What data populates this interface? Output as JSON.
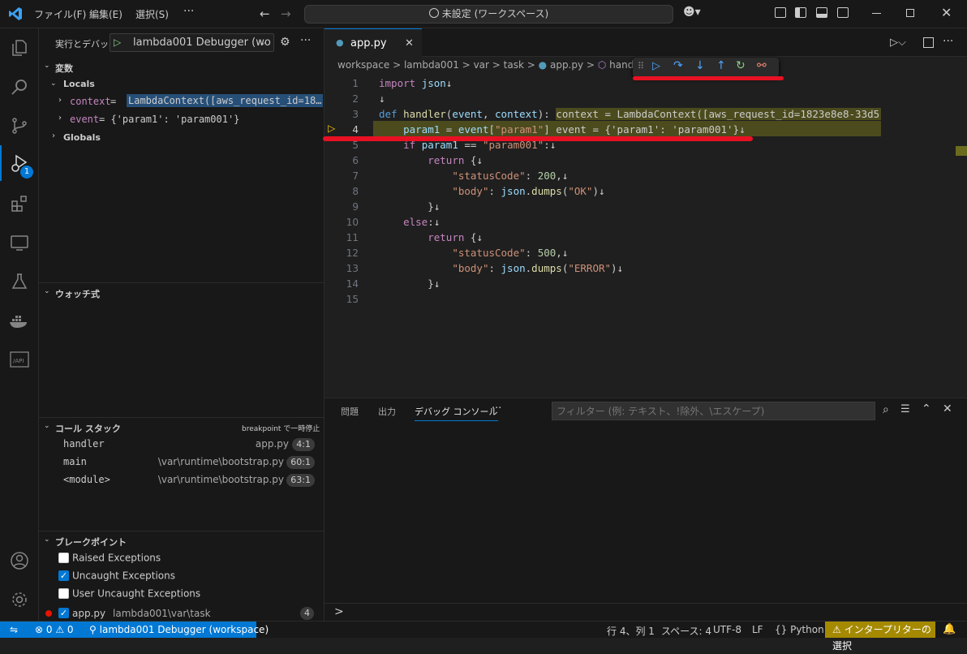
{
  "titlebar": {
    "menu_file": "ファイル(F)",
    "menu_edit": "編集(E)",
    "menu_select": "選択(S)",
    "menu_more": "···",
    "search": "未設定 (ワークスペース)"
  },
  "sidebar": {
    "run_label": "実行とデバッグ",
    "config": "lambda001 Debugger (wo",
    "variables": "変数",
    "locals": "Locals",
    "var_context_name": "context",
    "var_context_eq": " = ",
    "var_context_val": "LambdaContext([aws_request_id=18…",
    "var_event_name": "event",
    "var_event_val": " = {'param1': 'param001'}",
    "globals": "Globals",
    "watch": "ウォッチ式",
    "callstack": "コール スタック",
    "callstack_status": "breakpoint で一時停止",
    "frames": [
      {
        "name": "handler",
        "file": "app.py",
        "pos": "4:1"
      },
      {
        "name": "main",
        "file": "\\var\\runtime\\bootstrap.py",
        "pos": "60:1"
      },
      {
        "name": "<module>",
        "file": "\\var\\runtime\\bootstrap.py",
        "pos": "63:1"
      }
    ],
    "breakpoints": "ブレークポイント",
    "bp_raised": "Raised Exceptions",
    "bp_uncaught": "Uncaught Exceptions",
    "bp_user": "User Uncaught Exceptions",
    "bp_file": "app.py",
    "bp_path": "lambda001\\var\\task",
    "bp_line": "4"
  },
  "activity": {
    "debug_badge": "1"
  },
  "editor": {
    "tab": "app.py",
    "breadcrumb": [
      "workspace",
      ">",
      "lambda001",
      ">",
      "var",
      ">",
      "task",
      ">",
      "app.py",
      ">",
      "handle"
    ],
    "lines": [
      "1",
      "2",
      "3",
      "4",
      "5",
      "6",
      "7",
      "8",
      "9",
      "10",
      "11",
      "12",
      "13",
      "14",
      "15"
    ]
  },
  "panel": {
    "tab_problems": "問題",
    "tab_output": "出力",
    "tab_debug": "デバッグ コンソール",
    "tab_more": "···",
    "filter_placeholder": "フィルター (例: テキスト、!除外、\\エスケープ)",
    "prompt": ">"
  },
  "status": {
    "errors": "0",
    "warnings": "0",
    "debug": "lambda001 Debugger (workspace)",
    "pos": "行 4、列 1",
    "spaces": "スペース: 4",
    "encoding": "UTF-8",
    "eol": "LF",
    "lang": "Python",
    "interpreter": "インタープリターの選択"
  },
  "colors": {
    "accent": "#0078d4",
    "status_warn": "#a58a00",
    "annotation": "#e81123",
    "debug_toolbar": "#4fa3ff"
  }
}
